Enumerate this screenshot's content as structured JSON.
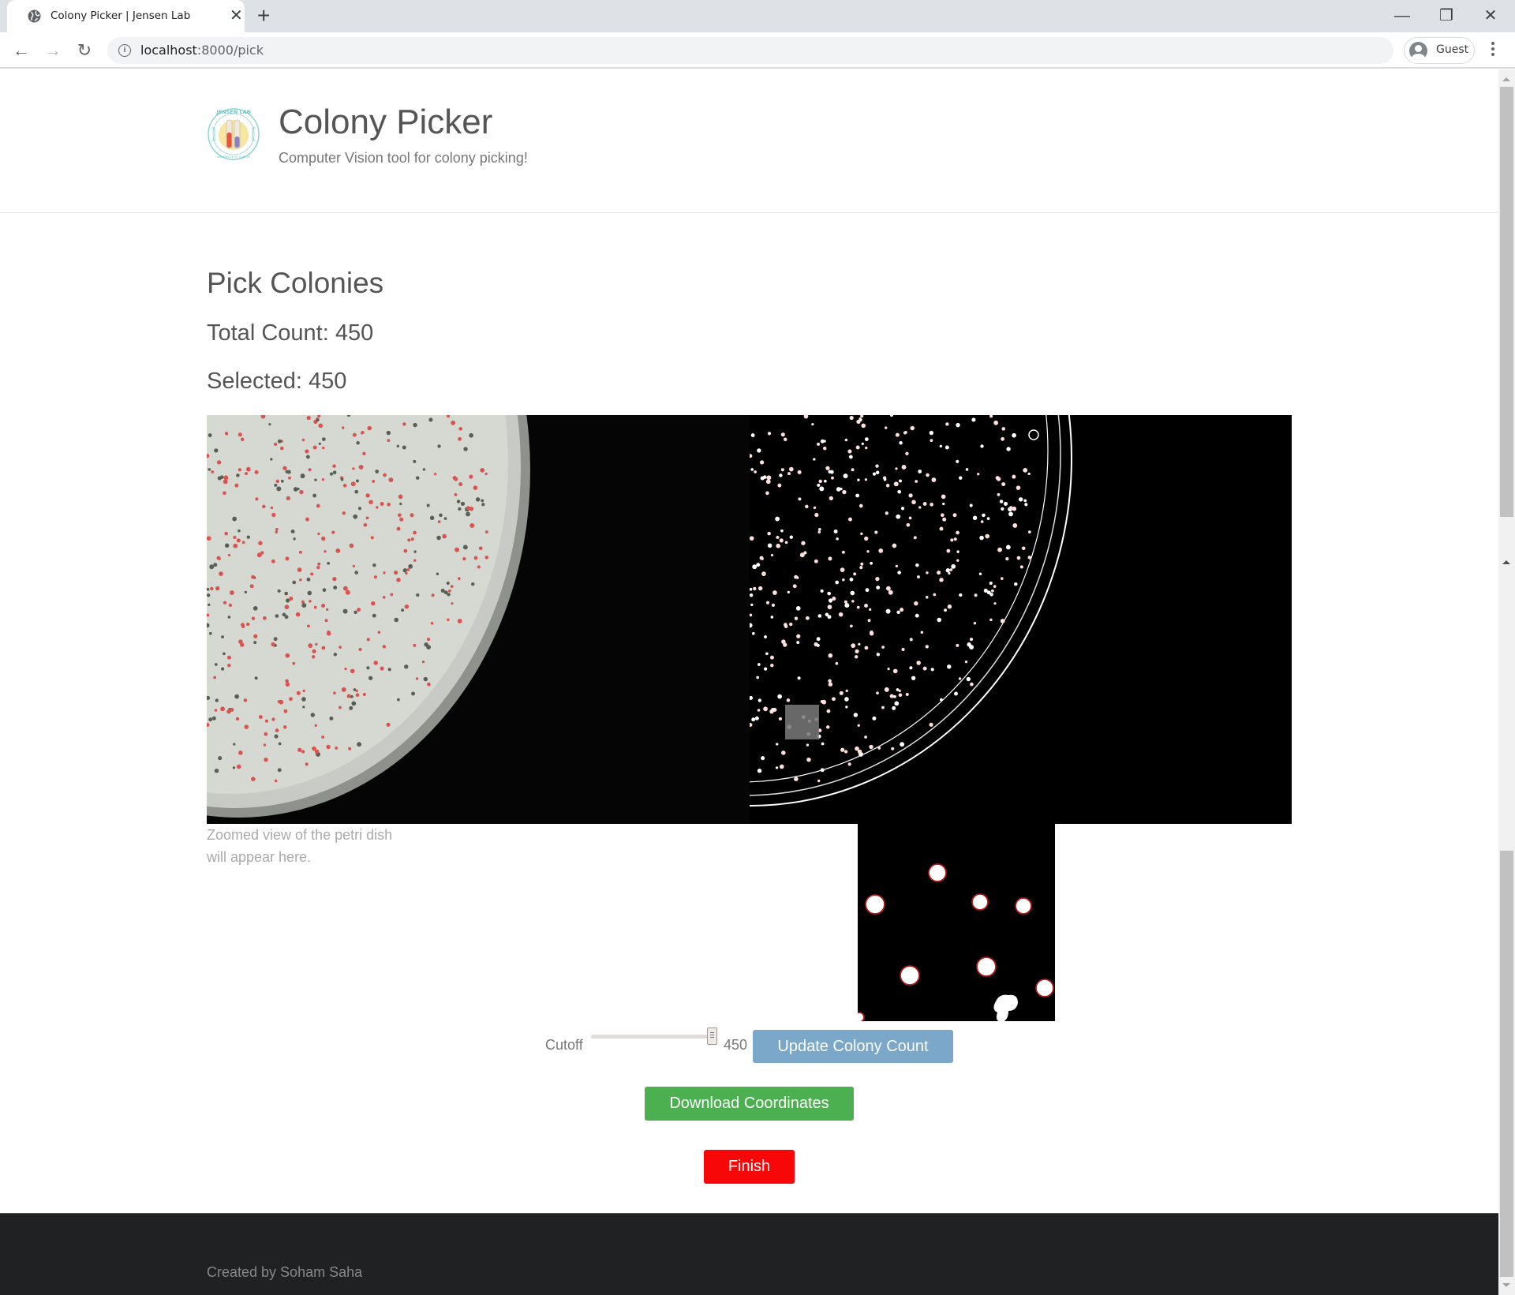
{
  "browser": {
    "tab_title": "Colony Picker | Jensen Lab",
    "url_host": "localhost",
    "url_path": ":8000/pick",
    "profile_label": "Guest",
    "new_tab_glyph": "+",
    "close_glyph": "✕",
    "minimize_glyph": "—",
    "maximize_glyph": "❐",
    "window_close_glyph": "✕",
    "back_glyph": "←",
    "forward_glyph": "→",
    "reload_glyph": "↻",
    "info_glyph": "i"
  },
  "header": {
    "logo_text": "JENSEN LAB",
    "logo_subtext": "UNIVERSITY OF ILLINOIS",
    "title": "Colony Picker",
    "subtitle": "Computer Vision tool for colony picking!"
  },
  "main": {
    "heading": "Pick Colonies",
    "total_count_label": "Total Count: 450",
    "selected_label": "Selected: 450",
    "zoom_placeholder": "Zoomed view of the petri dish will appear here.",
    "cutoff_label": "Cutoff",
    "cutoff_value": "450",
    "cutoff": {
      "value": 450,
      "max": 450
    },
    "update_button": "Update Colony Count",
    "download_button": "Download Coordinates",
    "finish_button": "Finish"
  },
  "colors": {
    "update_button": "#7ba7c9",
    "download_button": "#4caf50",
    "finish_button": "#f70707",
    "footer_bg": "#202123"
  },
  "footer": {
    "credit": "Created by Soham Saha"
  }
}
